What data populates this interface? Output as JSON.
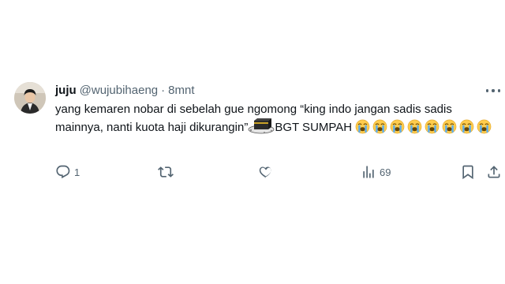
{
  "tweet": {
    "display_name": "juju",
    "handle": "@wujubihaeng",
    "separator": "·",
    "time": "8mnt",
    "text_part1": "yang kemaren nobar di sebelah gue ngomong “king indo jangan sadis sadis mainnya, nanti kuota haji dikurangin”",
    "text_part2": "BGT SUMPAH",
    "emoji_sticker": "kaaba-emoji",
    "emoji_repeat": "loudly-crying-face-emoji",
    "crying_emoji_count": 8
  },
  "actions": {
    "reply_count": "1",
    "repost_count": "",
    "like_count": "",
    "views_count": "69"
  },
  "icons": {
    "more": "more-icon",
    "reply": "reply-icon",
    "repost": "repost-icon",
    "like": "like-icon",
    "views": "views-icon",
    "bookmark": "bookmark-icon",
    "share": "share-icon"
  },
  "colors": {
    "text": "#0f1419",
    "secondary": "#536471",
    "background": "#ffffff"
  }
}
